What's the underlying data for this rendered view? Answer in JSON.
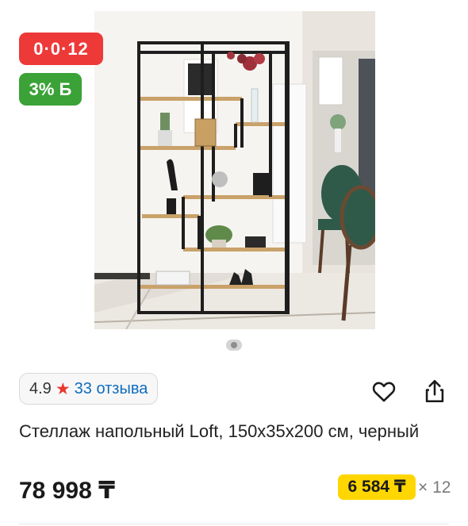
{
  "badges": {
    "installment": "0·0·12",
    "bonus": "3% Б"
  },
  "gallery": {
    "image_alt": "Стеллаж напольный Loft",
    "carousel_indicator": "dots"
  },
  "rating": {
    "score": "4.9",
    "star_icon": "★",
    "reviews": "33 отзыва"
  },
  "actions": {
    "favorite_icon": "heart-icon",
    "share_icon": "share-icon"
  },
  "product": {
    "title": "Стеллаж напольный Loft, 150х35х200 см, черный",
    "price": "78 998 ₸",
    "monthly_payment": "6 584 ₸",
    "months": "× 12"
  },
  "colors": {
    "installment_badge": "#ee3939",
    "bonus_badge": "#3aa236",
    "monthly_badge": "#ffd600",
    "link": "#0f6cbf",
    "star": "#e8382f"
  }
}
